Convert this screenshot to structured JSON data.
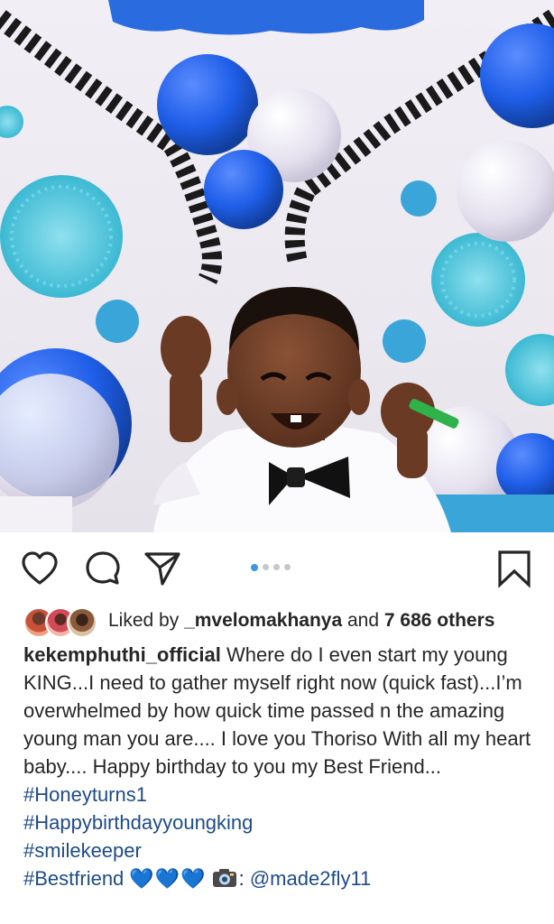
{
  "post": {
    "image_description_icon": "photo",
    "carousel": {
      "count": 4,
      "active_index": 0
    }
  },
  "actions": {
    "like_icon": "heart-outline-icon",
    "comment_icon": "comment-bubble-icon",
    "share_icon": "paper-plane-icon",
    "save_icon": "bookmark-outline-icon"
  },
  "likes": {
    "prefix": "Liked by ",
    "user": "_mvelomakhanya",
    "middle": " and ",
    "others": "7 686 others"
  },
  "caption": {
    "username": "kekemphuthi_official",
    "text": " Where do I even start my young KING...I need to gather myself right now (quick fast)...I’m overwhelmed by how quick time passed n the amazing young man you are.... I love you Thoriso With all my heart baby.... Happy birthday to you my Best Friend...",
    "hashtags": [
      "#Honeyturns1",
      "#Happybirthdayyoungking",
      "#smilekeeper"
    ],
    "last_tag": "#Bestfriend",
    "hearts": "💙💙💙",
    "credit_sep": ": ",
    "credit_mention": "@made2fly11"
  },
  "colors": {
    "accent_blue": "#3897f0",
    "hashtag": "#1e4b8a",
    "text": "#262626"
  }
}
